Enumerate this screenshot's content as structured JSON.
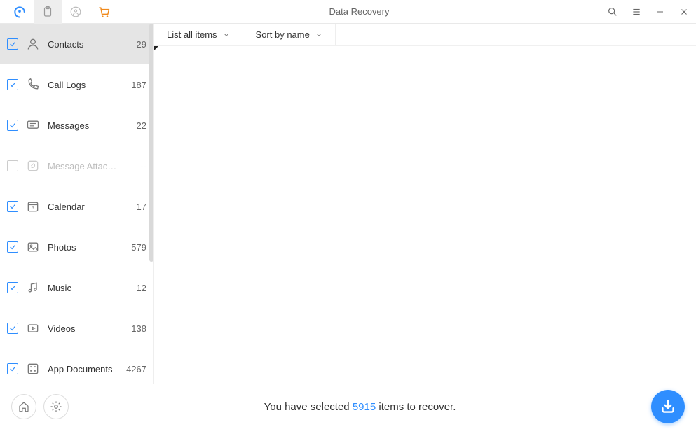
{
  "header": {
    "title": "Data Recovery"
  },
  "toolbar": {
    "filter_label": "List all items",
    "sort_label": "Sort by name"
  },
  "sidebar": {
    "items": [
      {
        "label": "Contacts",
        "count": "29",
        "checked": true,
        "active": true,
        "disabled": false,
        "icon": "person"
      },
      {
        "label": "Call Logs",
        "count": "187",
        "checked": true,
        "active": false,
        "disabled": false,
        "icon": "phone"
      },
      {
        "label": "Messages",
        "count": "22",
        "checked": true,
        "active": false,
        "disabled": false,
        "icon": "message"
      },
      {
        "label": "Message Attach...",
        "count": "--",
        "checked": false,
        "active": false,
        "disabled": true,
        "icon": "attachment"
      },
      {
        "label": "Calendar",
        "count": "17",
        "checked": true,
        "active": false,
        "disabled": false,
        "icon": "calendar"
      },
      {
        "label": "Photos",
        "count": "579",
        "checked": true,
        "active": false,
        "disabled": false,
        "icon": "photo"
      },
      {
        "label": "Music",
        "count": "12",
        "checked": true,
        "active": false,
        "disabled": false,
        "icon": "music"
      },
      {
        "label": "Videos",
        "count": "138",
        "checked": true,
        "active": false,
        "disabled": false,
        "icon": "video"
      },
      {
        "label": "App Documents",
        "count": "4267",
        "checked": true,
        "active": false,
        "disabled": false,
        "icon": "document"
      }
    ]
  },
  "footer": {
    "prefix": "You have selected ",
    "count": "5915",
    "suffix": " items to recover."
  }
}
